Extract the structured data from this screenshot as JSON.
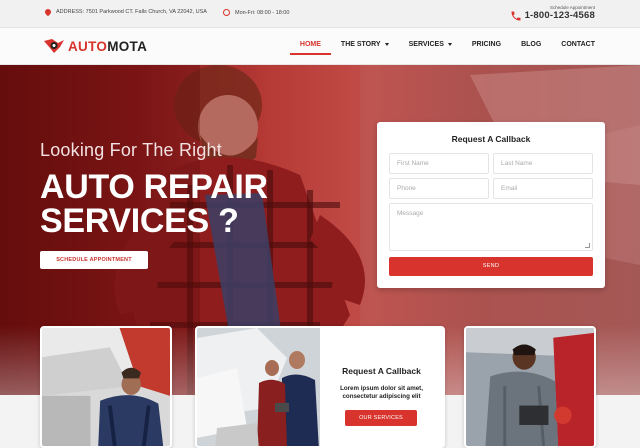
{
  "topbar": {
    "address": "ADDRESS: 7501 Parkwood CT. Falls Church, VA 22042, USA",
    "hours": "Mon-Fri: 08:00 - 18:00",
    "schedule_label": "Schedule Appointment",
    "phone": "1-800-123-4568"
  },
  "brand": {
    "name_part1": "AUTO",
    "name_part2": "MOTA"
  },
  "nav": {
    "items": [
      {
        "label": "HOME",
        "active": true
      },
      {
        "label": "THE STORY",
        "dropdown": true
      },
      {
        "label": "SERVICES",
        "dropdown": true
      },
      {
        "label": "PRICING"
      },
      {
        "label": "BLOG"
      },
      {
        "label": "CONTACT"
      }
    ]
  },
  "hero": {
    "subtitle": "Looking For The Right",
    "title_line1": "AUTO REPAIR",
    "title_line2": "SERVICES ?",
    "button": "SCHEDULE APPOINTMENT"
  },
  "callback_form": {
    "title": "Request A Callback",
    "first_name_placeholder": "First Name",
    "last_name_placeholder": "Last Name",
    "phone_placeholder": "Phone",
    "email_placeholder": "Email",
    "message_placeholder": "Message",
    "send": "SEND"
  },
  "cards": {
    "middle": {
      "title": "Request A Callback",
      "body": "Lorem ipsum dolor sit amet, consectetur adipiscing elit",
      "button": "OUR SERVICES"
    }
  },
  "colors": {
    "accent": "#d8332c",
    "dark": "#222222"
  },
  "icons": [
    "location-pin-icon",
    "clock-icon",
    "phone-icon",
    "logo-icon",
    "chevron-down-icon"
  ]
}
